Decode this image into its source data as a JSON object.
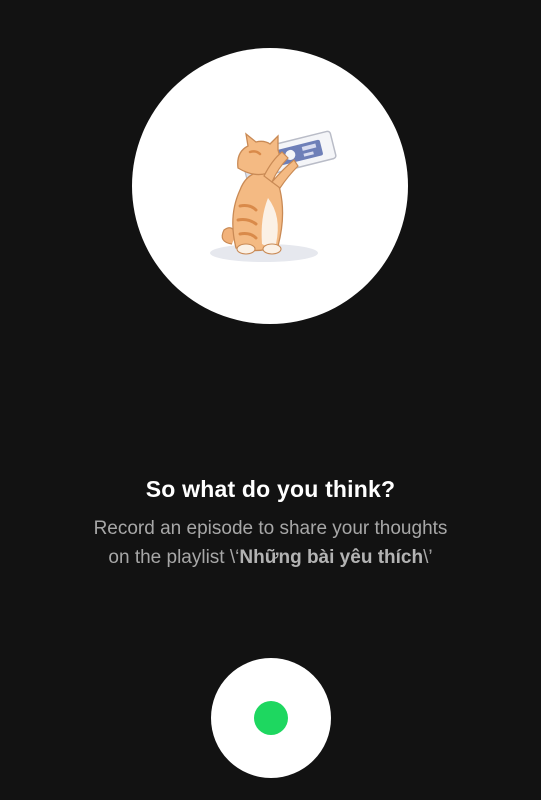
{
  "artwork": {
    "icon": "cat-drinking-milk-illustration"
  },
  "prompt": {
    "title": "So what do you think?",
    "body_prefix": "Record an episode to share your thoughts on the playlist \\‘",
    "playlist_name": "Những bài yêu thích",
    "body_suffix": "\\’"
  },
  "record_button": {
    "icon": "record-dot-icon",
    "dot_color": "#1ed760"
  },
  "colors": {
    "background": "#121212",
    "title": "#ffffff",
    "body": "#a7a7a7",
    "accent": "#1ed760"
  }
}
